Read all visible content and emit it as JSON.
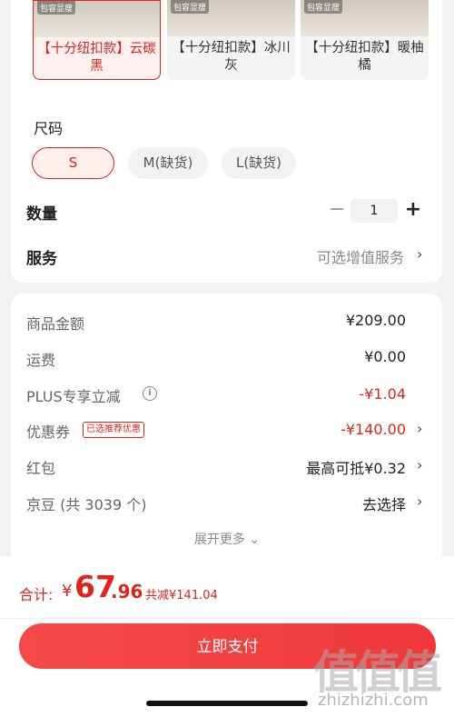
{
  "variants": [
    {
      "tag": "包容显瘦",
      "name": "【十分纽扣款】云碳黑",
      "selected": true
    },
    {
      "tag": "包容显瘦",
      "name": "【十分纽扣款】冰川灰",
      "selected": false
    },
    {
      "tag": "包容显瘦",
      "name": "【十分纽扣款】暖柚橘",
      "selected": false
    }
  ],
  "size": {
    "title": "尺码",
    "options": [
      {
        "label": "S",
        "selected": true
      },
      {
        "label": "M(缺货)",
        "selected": false
      },
      {
        "label": "L(缺货)",
        "selected": false
      }
    ]
  },
  "quantity": {
    "label": "数量",
    "minus": "−",
    "value": "1",
    "plus": "+"
  },
  "service": {
    "label": "服务",
    "value": "可选增值服务",
    "chevron": "›"
  },
  "price": {
    "goods_label": "商品金额",
    "goods_value": "¥209.00",
    "shipping_label": "运费",
    "shipping_value": "¥0.00",
    "plus_label": "PLUS专享立减",
    "plus_info_icon": "i",
    "plus_value": "-¥1.04",
    "coupon_label": "优惠券",
    "coupon_badge": "已选推荐优惠",
    "coupon_value": "-¥140.00",
    "redpacket_label": "红包",
    "redpacket_value": "最高可抵¥0.32",
    "jingdou_label": "京豆 (共 3039 个)",
    "jingdou_value": "去选择",
    "chevron": "›",
    "more": "展开更多 ⌄"
  },
  "total": {
    "label": "合计:",
    "yen": "¥",
    "integer": "67",
    "decimal": ".96",
    "saved": "共减¥141.04"
  },
  "pay_button": "立即支付",
  "watermark": {
    "text": "值值值",
    "url": "zhizhizhi.com"
  },
  "colors": {
    "accent": "#e2231a",
    "pay_button": "#f0383a",
    "background": "#f2f2f2"
  }
}
